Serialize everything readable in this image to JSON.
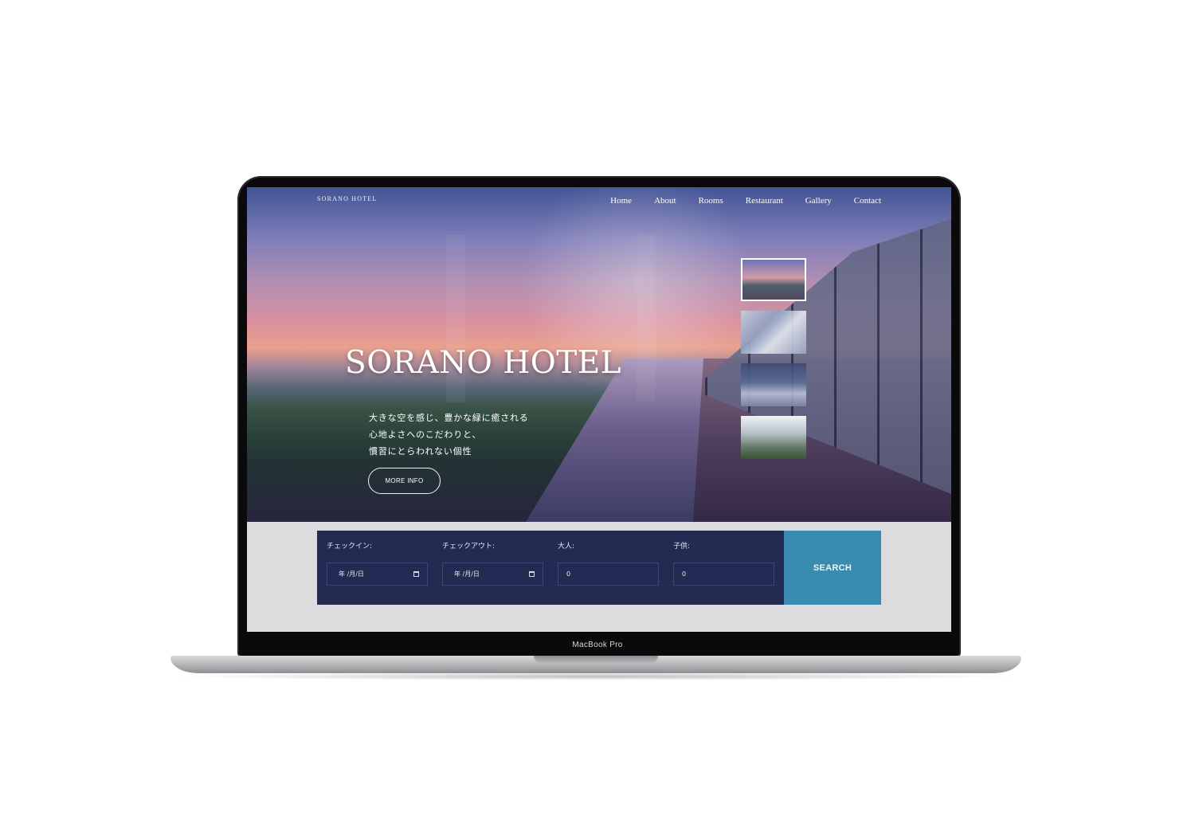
{
  "device": {
    "label": "MacBook Pro"
  },
  "site": {
    "logo": "SORANO HOTEL",
    "nav": [
      "Home",
      "About",
      "Rooms",
      "Restaurant",
      "Gallery",
      "Contact"
    ]
  },
  "hero": {
    "title": "SORANO HOTEL",
    "tagline": [
      "大きな空を感じ、豊かな緑に癒される",
      "心地よさへのこだわりと、",
      "慣習にとらわれない個性"
    ],
    "more_label": "MORE INFO",
    "thumbnails": [
      "rooftop-pool",
      "restaurant",
      "guest-room",
      "building-exterior"
    ]
  },
  "booking": {
    "checkin_label": "チェックイン:",
    "checkin_value": "年 /月/日",
    "checkout_label": "チェックアウト:",
    "checkout_value": "年 /月/日",
    "adults_label": "大人:",
    "adults_value": "0",
    "children_label": "子供:",
    "children_value": "0",
    "search_label": "SEARCH"
  },
  "colors": {
    "booking_bg": "#232b52",
    "search_bg": "#3a8bb0",
    "page_bg": "#dcdcde"
  }
}
